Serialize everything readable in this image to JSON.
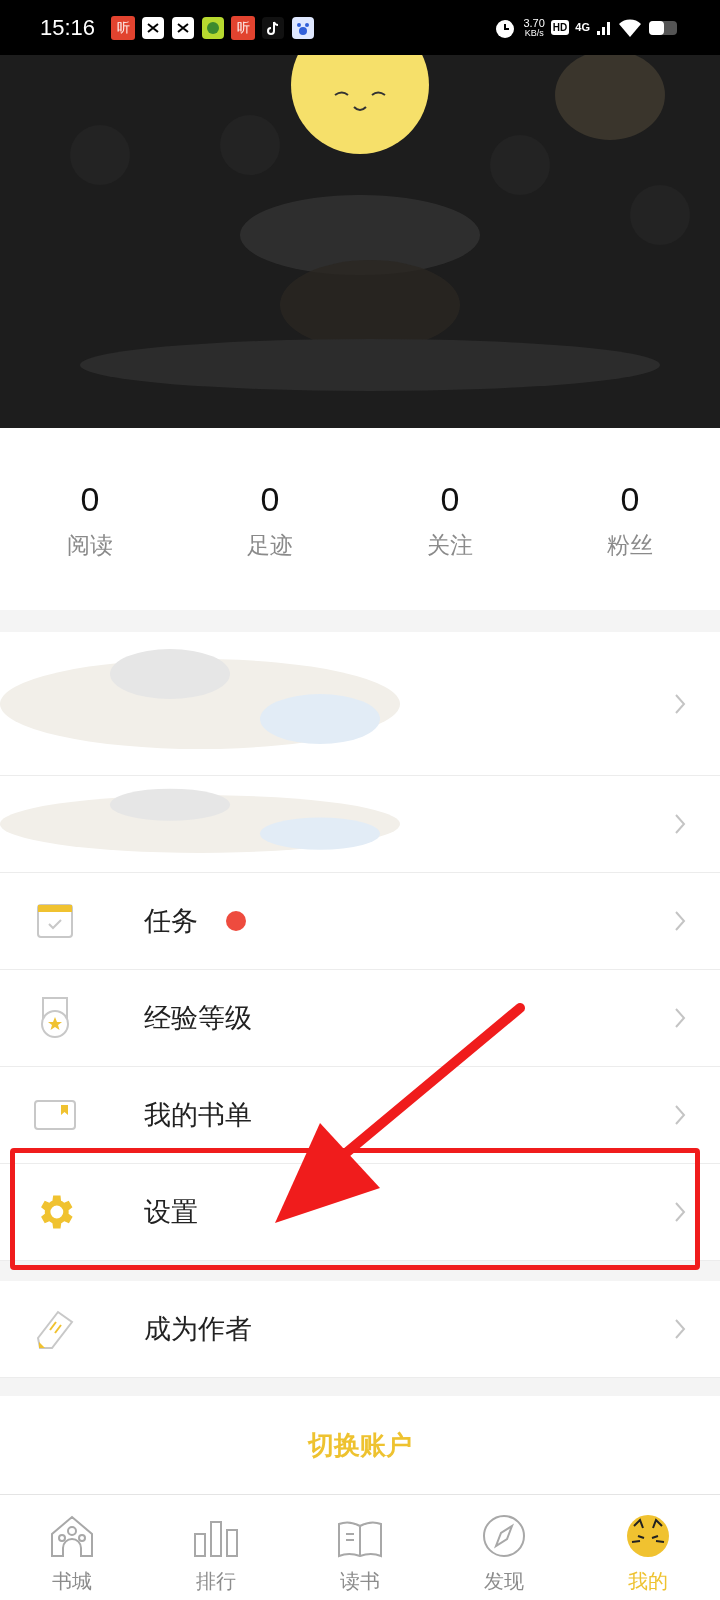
{
  "status_bar": {
    "time": "15:16",
    "notifications": [
      {
        "kind": "text",
        "text": "听"
      },
      {
        "kind": "scissors"
      },
      {
        "kind": "sogou"
      },
      {
        "kind": "music"
      },
      {
        "kind": "text",
        "text": "听"
      },
      {
        "kind": "tiktok"
      },
      {
        "kind": "paw"
      }
    ],
    "speed": "3.70",
    "speed_unit": "KB/s",
    "hd": "HD",
    "network": "4G"
  },
  "stats": [
    {
      "value": "0",
      "label": "阅读"
    },
    {
      "value": "0",
      "label": "足迹"
    },
    {
      "value": "0",
      "label": "关注"
    },
    {
      "value": "0",
      "label": "粉丝"
    }
  ],
  "menu": [
    {
      "kind": "blurred-tall"
    },
    {
      "kind": "blurred"
    },
    {
      "kind": "calendar",
      "label": "任务",
      "dot": true,
      "highlighted": false
    },
    {
      "kind": "medal",
      "label": "经验等级",
      "dot": false,
      "highlighted": false
    },
    {
      "kind": "card",
      "label": "我的书单",
      "dot": false,
      "highlighted": false
    },
    {
      "kind": "gear",
      "label": "设置",
      "dot": false,
      "highlighted": true
    }
  ],
  "author_menu": [
    {
      "kind": "pencil",
      "label": "成为作者",
      "dot": false,
      "highlighted": false
    }
  ],
  "switch_account": "切换账户",
  "tab_bar": [
    {
      "kind": "house",
      "label": "书城",
      "selected": false
    },
    {
      "kind": "bars",
      "label": "排行",
      "selected": false
    },
    {
      "kind": "book",
      "label": "读书",
      "selected": false
    },
    {
      "kind": "compass",
      "label": "发现",
      "selected": false
    },
    {
      "kind": "cat",
      "label": "我的",
      "selected": true
    }
  ]
}
